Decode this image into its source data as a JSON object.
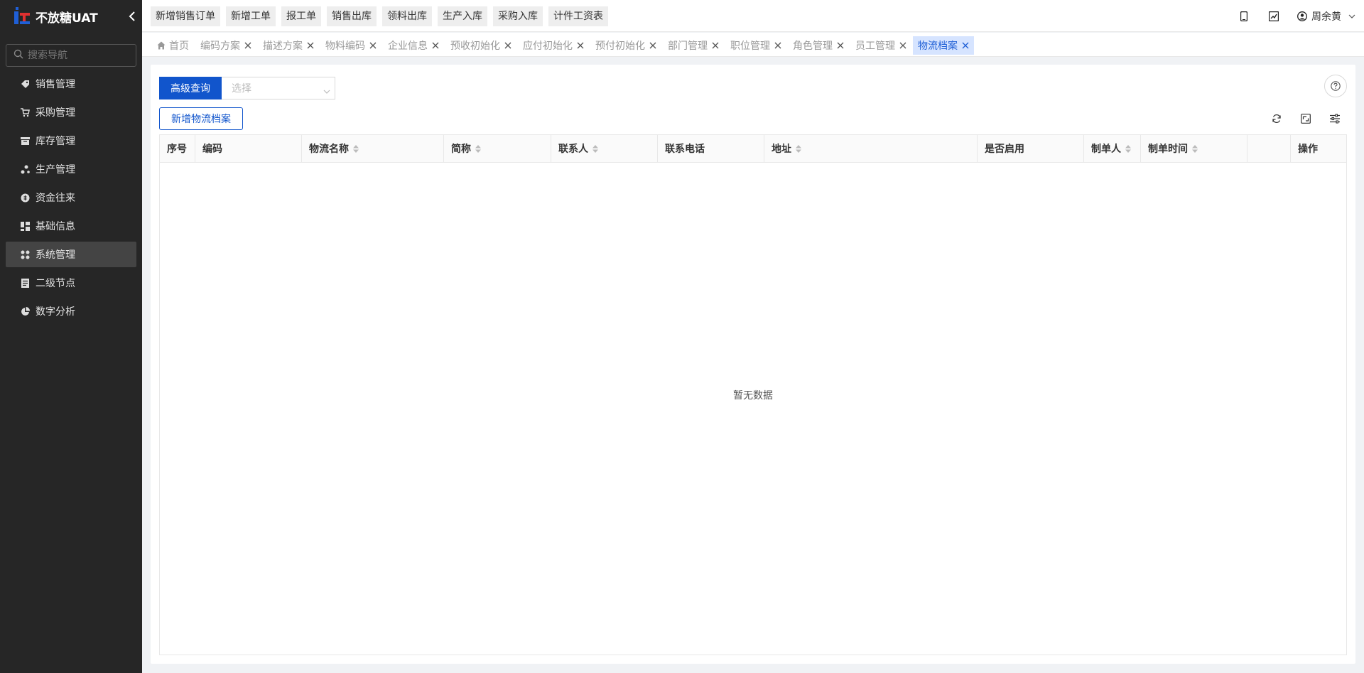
{
  "brand": {
    "title": "不放糖UAT"
  },
  "sidebar": {
    "search_placeholder": "搜索导航",
    "items": [
      {
        "label": "销售管理",
        "icon": "tag-icon"
      },
      {
        "label": "采购管理",
        "icon": "cart-icon"
      },
      {
        "label": "库存管理",
        "icon": "box-icon"
      },
      {
        "label": "生产管理",
        "icon": "nodes-icon"
      },
      {
        "label": "资金往来",
        "icon": "coin-icon"
      },
      {
        "label": "基础信息",
        "icon": "blocks-icon"
      },
      {
        "label": "系统管理",
        "icon": "grid-icon",
        "active": true
      },
      {
        "label": "二级节点",
        "icon": "doc-icon"
      },
      {
        "label": "数字分析",
        "icon": "pie-icon"
      }
    ]
  },
  "quick_actions": [
    "新增销售订单",
    "新增工单",
    "报工单",
    "销售出库",
    "领料出库",
    "生产入库",
    "采购入库",
    "计件工资表"
  ],
  "user": {
    "name": "周余黄"
  },
  "tabs": [
    {
      "label": "首页",
      "home": true
    },
    {
      "label": "编码方案"
    },
    {
      "label": "描述方案"
    },
    {
      "label": "物料编码"
    },
    {
      "label": "企业信息"
    },
    {
      "label": "预收初始化"
    },
    {
      "label": "应付初始化"
    },
    {
      "label": "预付初始化"
    },
    {
      "label": "部门管理"
    },
    {
      "label": "职位管理"
    },
    {
      "label": "角色管理"
    },
    {
      "label": "员工管理"
    },
    {
      "label": "物流档案",
      "active": true
    }
  ],
  "query": {
    "button": "高级查询",
    "select_placeholder": "选择"
  },
  "add_button": "新增物流档案",
  "table": {
    "columns": [
      "序号",
      "编码",
      "物流名称",
      "简称",
      "联系人",
      "联系电话",
      "地址",
      "是否启用",
      "制单人",
      "制单时间",
      "",
      "操作"
    ],
    "empty_text": "暂无数据"
  },
  "colors": {
    "primary": "#1155cc",
    "sidebar_bg": "#262626",
    "active_tab_bg": "#d6e4ff"
  }
}
